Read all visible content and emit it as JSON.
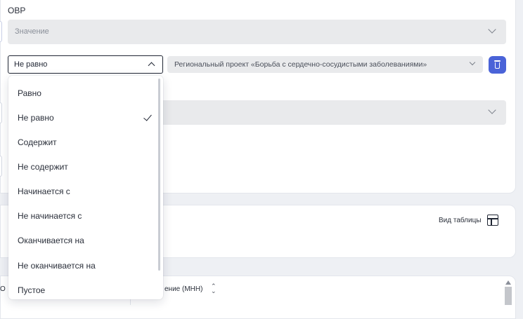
{
  "filter": {
    "label": "ОВР",
    "value_placeholder": "Значение",
    "condition_selected": "Не равно",
    "project_value": "Региональный проект «Борьба с сердечно-сосудистыми заболеваниями»",
    "condition_options": [
      "Равно",
      "Не равно",
      "Содержит",
      "Не содержит",
      "Начинается с",
      "Не начинается с",
      "Оканчивается на",
      "Не оканчивается на",
      "Пустое"
    ],
    "selected_index": 1
  },
  "view": {
    "table_view_label": "Вид таблицы"
  },
  "table": {
    "left_header_fragment": "О",
    "header_name": "ение (МНН)"
  },
  "colors": {
    "accent": "#4a63d8",
    "field_bg": "#e9eaec",
    "page_bg": "#eef0f4"
  },
  "icons": [
    "chevron-down-icon",
    "chevron-up-icon",
    "trash-icon",
    "check-icon",
    "table-layout-icon",
    "sort-icon"
  ]
}
